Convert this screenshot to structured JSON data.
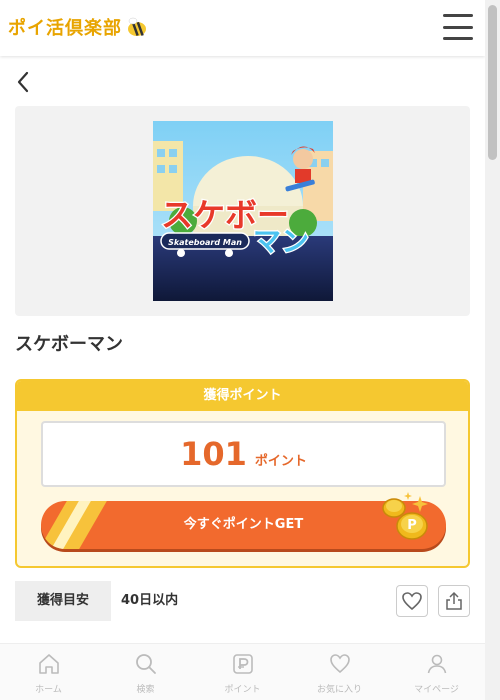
{
  "header": {
    "logo_text": "ポイ活倶楽部",
    "menu_icon": "hamburger-icon"
  },
  "back_icon": "chevron-left-icon",
  "app": {
    "title": "スケボーマン",
    "thumbnail_title": "スケボーマン",
    "thumbnail_subtitle": "Skateboard Man"
  },
  "points": {
    "header": "獲得ポイント",
    "value": "101",
    "unit": "ポイント",
    "get_button": "今すぐポイントGET"
  },
  "estimate": {
    "label": "獲得目安",
    "value": "40日以内"
  },
  "actions": {
    "favorite_icon": "heart-icon",
    "share_icon": "share-icon"
  },
  "nav": [
    {
      "label": "ホーム",
      "icon": "home-icon"
    },
    {
      "label": "検索",
      "icon": "search-icon"
    },
    {
      "label": "ポイント",
      "icon": "point-icon"
    },
    {
      "label": "お気に入り",
      "icon": "heart-icon"
    },
    {
      "label": "マイページ",
      "icon": "user-icon"
    }
  ],
  "colors": {
    "accent": "#f26a2e",
    "yellow": "#f5c830",
    "points_text": "#e5682b",
    "logo": "#e8a400"
  }
}
